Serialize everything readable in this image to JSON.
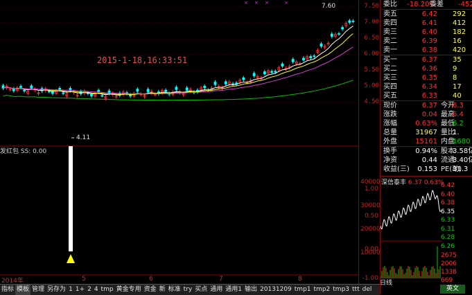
{
  "main_chart": {
    "timestamp": "2015-1-18,16:33:51",
    "high_label": "7.60",
    "low_label": "4.11",
    "price_axis": [
      "7.50",
      "7.00",
      "6.50",
      "6.00",
      "5.50",
      "5.00",
      "4.50"
    ],
    "x_labels": [
      "2014年",
      "5",
      "6",
      "7",
      "8",
      "9"
    ]
  },
  "sub_chart": {
    "label": "发红包  SS: 0.00",
    "axis": [
      "-1.00",
      "-0.50",
      "0.00",
      "0.50",
      "1.00"
    ]
  },
  "quote": {
    "header": {
      "label1": "委比",
      "value1": "-18.20%",
      "label2": "委差",
      "value2": "-452"
    },
    "sell": [
      {
        "label": "卖五",
        "price": "6.42",
        "vol": "292"
      },
      {
        "label": "卖四",
        "price": "6.41",
        "vol": "412"
      },
      {
        "label": "卖三",
        "price": "6.40",
        "vol": "182"
      },
      {
        "label": "卖二",
        "price": "6.39",
        "vol": "16"
      },
      {
        "label": "卖一",
        "price": "6.38",
        "vol": "420"
      }
    ],
    "buy": [
      {
        "label": "买一",
        "price": "6.37",
        "vol": "35"
      },
      {
        "label": "买二",
        "price": "6.36",
        "vol": "9"
      },
      {
        "label": "买三",
        "price": "6.35",
        "vol": "8"
      },
      {
        "label": "买四",
        "price": "6.34",
        "vol": "17"
      },
      {
        "label": "买五",
        "price": "6.33",
        "vol": "40"
      }
    ],
    "stats": [
      {
        "l1": "现价",
        "v1": "6.37",
        "l2": "今开",
        "v2": "6.3"
      },
      {
        "l1": "涨跌",
        "v1": "0.04",
        "l2": "最高",
        "v2": "6.4"
      },
      {
        "l1": "涨幅",
        "v1": "0.63%",
        "l2": "最低",
        "v2": "6.2"
      },
      {
        "l1": "总量",
        "v1": "31967",
        "l2": "量比",
        "v2": "1."
      },
      {
        "l1": "外盘",
        "v1": "15161",
        "l2": "内盘",
        "v2": "1680"
      }
    ],
    "stats2": [
      {
        "l1": "换手",
        "v1": "0.94%",
        "l2": "股本",
        "v2": "3.58亿"
      },
      {
        "l1": "净资",
        "v1": "0.44",
        "l2": "流通",
        "v2": "3.40亿"
      },
      {
        "l1": "收益(三)",
        "v1": "0.153",
        "l2": "PE(动)",
        "v2": "31.3"
      }
    ]
  },
  "mini_chart": {
    "title": "深信泰丰",
    "price": "6.37",
    "pct": "0.63%",
    "y_prices": [
      "6.42",
      "6.40",
      "6.38",
      "6.35",
      "6.33",
      "6.31",
      "6.28",
      "6.26"
    ],
    "vol_axis": [
      "40000",
      "30000",
      "20000",
      "10000"
    ],
    "vol_right": [
      "2675",
      "2006",
      "1338",
      "669"
    ]
  },
  "tabs": [
    "指标",
    "模板",
    "管理",
    "另存为",
    "1",
    "1+",
    "2",
    "4",
    "tmp",
    "黄金专用",
    "资金",
    "新",
    "标准",
    "try",
    "买点",
    "通用",
    "通用1",
    "输出",
    "20131209",
    "tmp1",
    "tmp2",
    "tmp3",
    "ttt",
    "del"
  ],
  "footer": {
    "period": "日线",
    "button": "英文"
  },
  "colors": {
    "up": "#ff3030",
    "down": "#00ffff",
    "ma1": "#ffffff",
    "ma2": "#ffff00",
    "ma3": "#d040d0",
    "ma4": "#00c000"
  }
}
